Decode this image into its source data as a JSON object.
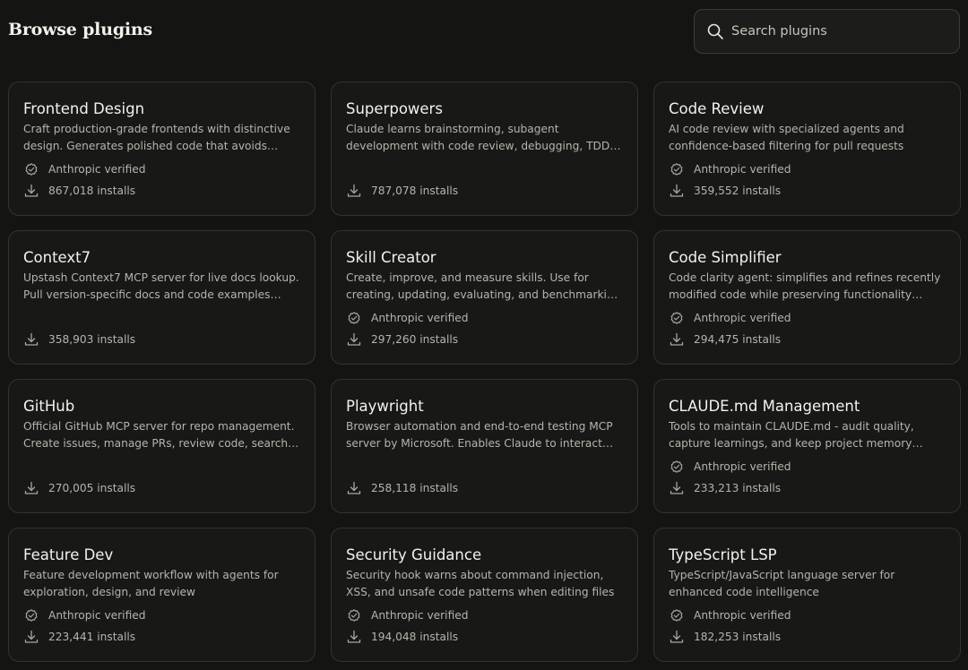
{
  "header": {
    "title": "Browse plugins",
    "search": {
      "placeholder": "Search plugins",
      "value": "",
      "icon": "search-icon"
    }
  },
  "plugins": [
    {
      "name": "Frontend Design",
      "description": "Craft production-grade frontends with distinctive design. Generates polished code that avoids generic…",
      "verified": true,
      "verified_label": "Anthropic verified",
      "installs": "867,018 installs"
    },
    {
      "name": "Superpowers",
      "description": "Claude learns brainstorming, subagent development with code review, debugging, TDD, and skill authorin…",
      "verified": false,
      "installs": "787,078 installs"
    },
    {
      "name": "Code Review",
      "description": "AI code review with specialized agents and confidence-based filtering for pull requests",
      "verified": true,
      "verified_label": "Anthropic verified",
      "installs": "359,552 installs"
    },
    {
      "name": "Context7",
      "description": "Upstash Context7 MCP server for live docs lookup. Pull version-specific docs and code examples from…",
      "verified": false,
      "installs": "358,903 installs"
    },
    {
      "name": "Skill Creator",
      "description": "Create, improve, and measure skills. Use for creating, updating, evaluating, and benchmarking performance.",
      "verified": true,
      "verified_label": "Anthropic verified",
      "installs": "297,260 installs"
    },
    {
      "name": "Code Simplifier",
      "description": "Code clarity agent: simplifies and refines recently modified code while preserving functionality and…",
      "verified": true,
      "verified_label": "Anthropic verified",
      "installs": "294,475 installs"
    },
    {
      "name": "GitHub",
      "description": "Official GitHub MCP server for repo management. Create issues, manage PRs, review code, search rep…",
      "verified": false,
      "installs": "270,005 installs"
    },
    {
      "name": "Playwright",
      "description": "Browser automation and end-to-end testing MCP server by Microsoft. Enables Claude to interact with…",
      "verified": false,
      "installs": "258,118 installs"
    },
    {
      "name": "CLAUDE.md Management",
      "description": "Tools to maintain CLAUDE.md - audit quality, capture learnings, and keep project memory current.",
      "verified": true,
      "verified_label": "Anthropic verified",
      "installs": "233,213 installs"
    },
    {
      "name": "Feature Dev",
      "description": "Feature development workflow with agents for exploration, design, and review",
      "verified": true,
      "verified_label": "Anthropic verified",
      "installs": "223,441 installs"
    },
    {
      "name": "Security Guidance",
      "description": "Security hook warns about command injection, XSS, and unsafe code patterns when editing files",
      "verified": true,
      "verified_label": "Anthropic verified",
      "installs": "194,048 installs"
    },
    {
      "name": "TypeScript LSP",
      "description": "TypeScript/JavaScript language server for enhanced code intelligence",
      "verified": true,
      "verified_label": "Anthropic verified",
      "installs": "182,253 installs"
    }
  ],
  "icons": {
    "verified": "verified-badge-icon",
    "installs": "download-icon"
  },
  "colors": {
    "background": "#141413",
    "card": "#181817",
    "border": "#34332f",
    "text": "#f4f2ea",
    "muted": "#b6b4aa"
  }
}
